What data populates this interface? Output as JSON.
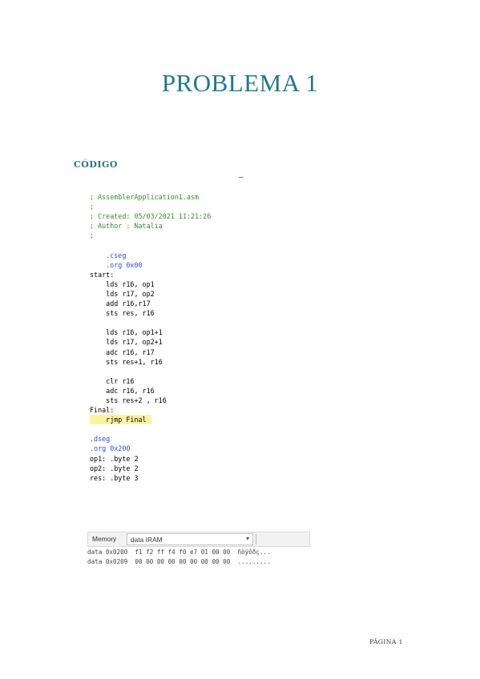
{
  "title": "PROBLEMA 1",
  "section_heading": "CÓDIGO",
  "dash": "–",
  "code_lines": [
    {
      "text": "; AssemblerApplication1.asm",
      "kind": "comment"
    },
    {
      "text": ";",
      "kind": "comment"
    },
    {
      "text": "; Created: 05/03/2021 11:21:26",
      "kind": "comment"
    },
    {
      "text": "; Author : Natalia",
      "kind": "comment"
    },
    {
      "text": ";",
      "kind": "comment"
    },
    {
      "text": "",
      "kind": "plain"
    },
    {
      "text": "    .cseg",
      "kind": "directive"
    },
    {
      "text": "    .org 0x00",
      "kind": "directive"
    },
    {
      "text": "start:",
      "kind": "plain"
    },
    {
      "text": "    lds r16, op1",
      "kind": "plain"
    },
    {
      "text": "    lds r17, op2",
      "kind": "plain"
    },
    {
      "text": "    add r16,r17",
      "kind": "plain"
    },
    {
      "text": "    sts res, r16",
      "kind": "plain"
    },
    {
      "text": "",
      "kind": "plain"
    },
    {
      "text": "    lds r16, op1+1",
      "kind": "plain"
    },
    {
      "text": "    lds r17, op2+1",
      "kind": "plain"
    },
    {
      "text": "    adc r16, r17",
      "kind": "plain"
    },
    {
      "text": "    sts res+1, r16",
      "kind": "plain"
    },
    {
      "text": "",
      "kind": "plain"
    },
    {
      "text": "    clr r16",
      "kind": "plain"
    },
    {
      "text": "    adc r16, r16",
      "kind": "plain"
    },
    {
      "text": "    sts res+2 , r16",
      "kind": "plain"
    },
    {
      "text": "Final:",
      "kind": "plain"
    },
    {
      "text": "    rjmp Final",
      "kind": "highlight"
    },
    {
      "text": "",
      "kind": "plain"
    },
    {
      "text": ".dseg",
      "kind": "directive"
    },
    {
      "text": ".org 0x200",
      "kind": "directive"
    },
    {
      "text": "op1: .byte 2",
      "kind": "plain"
    },
    {
      "text": "op2: .byte 2",
      "kind": "plain"
    },
    {
      "text": "res: .byte 3",
      "kind": "plain"
    }
  ],
  "memory": {
    "label": "Memory",
    "selected": "data IRAM",
    "rows": [
      "data 0x0200  f1 f2 ff f4 f0 e7 01 00 00  ñòÿôðç...",
      "data 0x0209  00 00 00 00 00 00 00 00 00  ........."
    ]
  },
  "footer": "PÁGINA 1",
  "colors": {
    "title": "#1f7a8c",
    "comment": "#3a8a2a",
    "directive": "#2a4ed8",
    "highlight": "#fbf3a2"
  }
}
